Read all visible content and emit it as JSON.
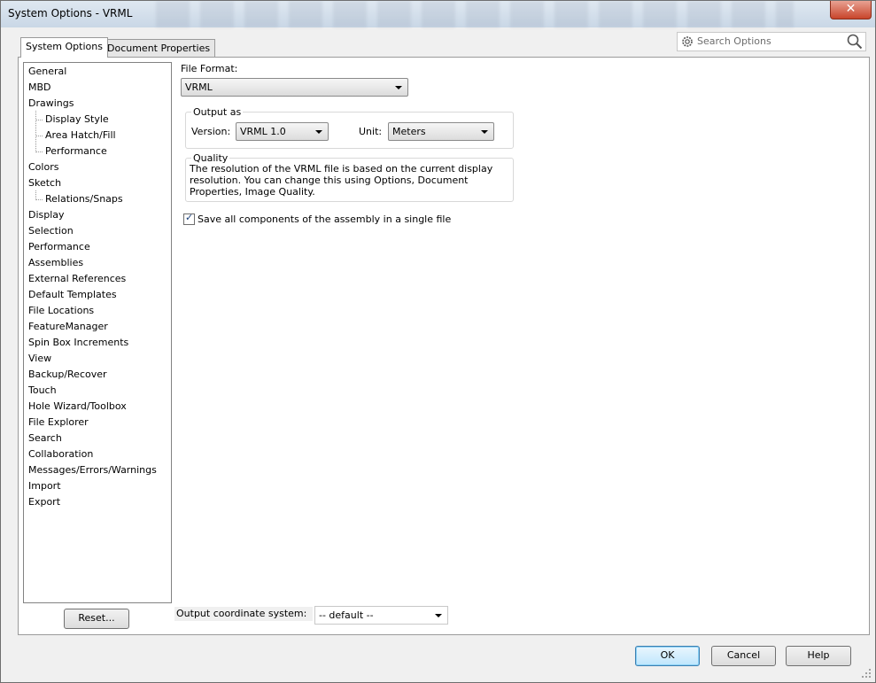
{
  "window": {
    "title": "System Options - VRML",
    "close_glyph": "✕"
  },
  "tabs": [
    {
      "label": "System Options",
      "active": true
    },
    {
      "label": "Document Properties",
      "active": false
    }
  ],
  "search": {
    "placeholder": "Search Options",
    "icon": "gear-icon",
    "search_icon": "magnifier-icon"
  },
  "tree": {
    "items": [
      {
        "label": "General",
        "level": 0
      },
      {
        "label": "MBD",
        "level": 0
      },
      {
        "label": "Drawings",
        "level": 0
      },
      {
        "label": "Display Style",
        "level": 1
      },
      {
        "label": "Area Hatch/Fill",
        "level": 1
      },
      {
        "label": "Performance",
        "level": 1
      },
      {
        "label": "Colors",
        "level": 0
      },
      {
        "label": "Sketch",
        "level": 0
      },
      {
        "label": "Relations/Snaps",
        "level": 1
      },
      {
        "label": "Display",
        "level": 0
      },
      {
        "label": "Selection",
        "level": 0
      },
      {
        "label": "Performance",
        "level": 0
      },
      {
        "label": "Assemblies",
        "level": 0
      },
      {
        "label": "External References",
        "level": 0
      },
      {
        "label": "Default Templates",
        "level": 0
      },
      {
        "label": "File Locations",
        "level": 0
      },
      {
        "label": "FeatureManager",
        "level": 0
      },
      {
        "label": "Spin Box Increments",
        "level": 0
      },
      {
        "label": "View",
        "level": 0
      },
      {
        "label": "Backup/Recover",
        "level": 0
      },
      {
        "label": "Touch",
        "level": 0
      },
      {
        "label": "Hole Wizard/Toolbox",
        "level": 0
      },
      {
        "label": "File Explorer",
        "level": 0
      },
      {
        "label": "Search",
        "level": 0
      },
      {
        "label": "Collaboration",
        "level": 0
      },
      {
        "label": "Messages/Errors/Warnings",
        "level": 0
      },
      {
        "label": "Import",
        "level": 0
      },
      {
        "label": "Export",
        "level": 0
      }
    ]
  },
  "main": {
    "file_format_label": "File Format:",
    "file_format_value": "VRML",
    "output_as": {
      "legend": "Output as",
      "version_label": "Version:",
      "version_value": "VRML 1.0",
      "unit_label": "Unit:",
      "unit_value": "Meters"
    },
    "quality": {
      "legend": "Quality",
      "text": "The resolution of the VRML file is based on the current display resolution. You can change this using Options, Document Properties, Image Quality."
    },
    "save_all_checkbox": {
      "label": "Save all components of the assembly in a single file",
      "checked": true
    },
    "coord_system_label": "Output coordinate system:",
    "coord_system_value": "-- default --"
  },
  "buttons": {
    "reset": "Reset...",
    "ok": "OK",
    "cancel": "Cancel",
    "help": "Help"
  }
}
